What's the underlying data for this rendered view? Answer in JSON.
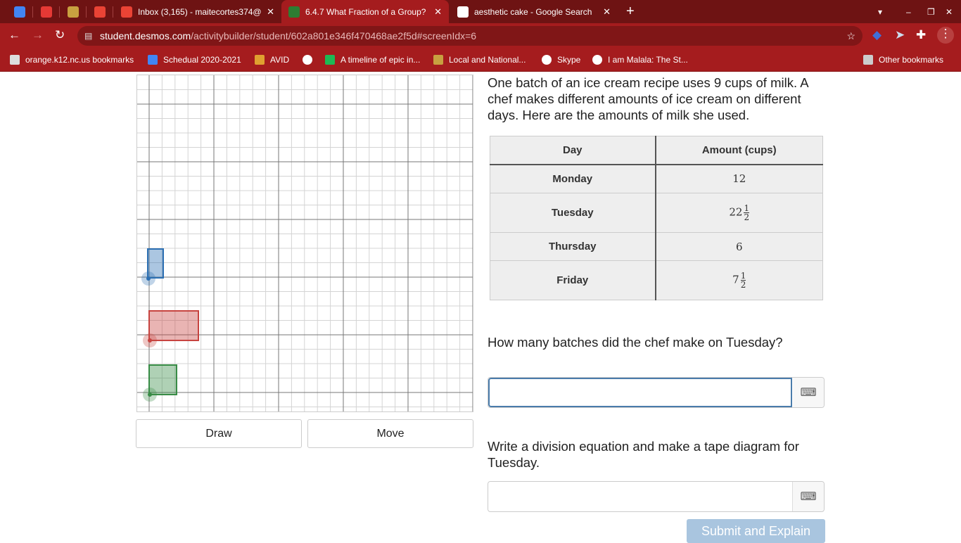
{
  "browser": {
    "tabs": [
      {
        "label": "",
        "icon": "docs-icon",
        "color": "#4285f4"
      },
      {
        "label": "",
        "icon": "app-icon",
        "color": "#e53935"
      },
      {
        "label": "",
        "icon": "school-seal-icon",
        "color": "#c8a040"
      },
      {
        "label": "",
        "icon": "gmail-icon",
        "color": "#ea4335"
      },
      {
        "label": "Inbox (3,165) - maitecortes374@",
        "icon": "gmail-icon",
        "color": "#ea4335"
      },
      {
        "label": "6.4.7 What Fraction of a Group?",
        "icon": "desmos-icon",
        "color": "#2e7d32",
        "active": true
      },
      {
        "label": "aesthetic cake - Google Search",
        "icon": "google-icon",
        "color": "#ffffff"
      }
    ],
    "url_host": "student.desmos.com",
    "url_path": "/activitybuilder/student/602a801e346f470468ae2f5d#screenIdx=6",
    "bookmarks": [
      "orange.k12.nc.us bookmarks",
      "Schedual 2020-2021",
      "AVID",
      "",
      "A timeline of epic in...",
      "Local and National...",
      "Skype",
      "I am Malala: The St..."
    ],
    "other_bookmarks": "Other bookmarks"
  },
  "graph": {
    "colors": {
      "blue": "#2d70b3",
      "red": "#c74440",
      "green": "#388c46"
    }
  },
  "buttons": {
    "draw": "Draw",
    "move": "Move",
    "submit": "Submit and Explain"
  },
  "prompt": "One batch of an ice cream recipe uses 9 cups of milk. A chef makes different amounts of ice cream on different days. Here are the amounts of milk she used.",
  "table": {
    "headers": [
      "Day",
      "Amount (cups)"
    ],
    "rows": [
      {
        "day": "Monday",
        "whole": "12",
        "num": "",
        "den": ""
      },
      {
        "day": "Tuesday",
        "whole": "22",
        "num": "1",
        "den": "2"
      },
      {
        "day": "Thursday",
        "whole": "6",
        "num": "",
        "den": ""
      },
      {
        "day": "Friday",
        "whole": "7",
        "num": "1",
        "den": "2"
      }
    ]
  },
  "question1": "How many batches did the chef make on Tuesday?",
  "question2": "Write a division equation and make a tape diagram for Tuesday.",
  "answer1": "",
  "answer2": ""
}
